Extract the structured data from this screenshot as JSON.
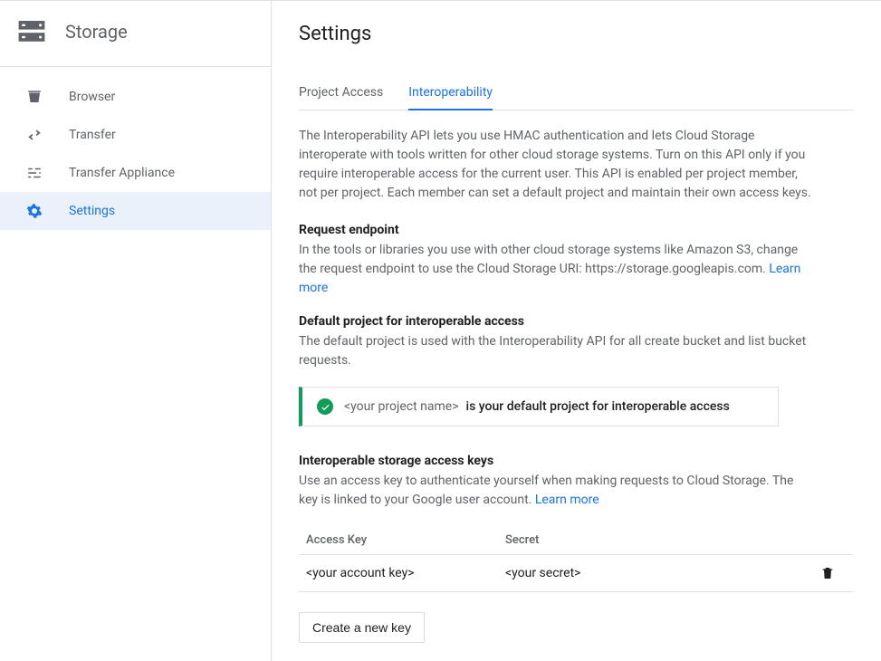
{
  "sidebar": {
    "product": "Storage",
    "items": [
      {
        "label": "Browser"
      },
      {
        "label": "Transfer"
      },
      {
        "label": "Transfer Appliance"
      },
      {
        "label": "Settings"
      }
    ]
  },
  "page": {
    "title": "Settings"
  },
  "tabs": [
    {
      "label": "Project Access"
    },
    {
      "label": "Interoperability"
    }
  ],
  "intro": "The Interoperability API lets you use HMAC authentication and lets Cloud Storage interoperate with tools written for other cloud storage systems. Turn on this API only if you require interoperable access for the current user. This API is enabled per project member, not per project. Each member can set a default project and maintain their own access keys.",
  "request_endpoint": {
    "title": "Request endpoint",
    "text": "In the tools or libraries you use with other cloud storage systems like Amazon S3, change the request endpoint to use the Cloud Storage URI: https://storage.googleapis.com. ",
    "learn_more": "Learn more"
  },
  "default_project": {
    "title": "Default project for interoperable access",
    "text": "The default project is used with the Interoperability API for all create bucket and list bucket requests.",
    "project_name": "<your project name>",
    "message": "is your default project for interoperable access"
  },
  "access_keys": {
    "title": "Interoperable storage access keys",
    "text": "Use an access key to authenticate yourself when making requests to Cloud Storage. The key is linked to your Google user account. ",
    "learn_more": "Learn more",
    "columns": {
      "key": "Access Key",
      "secret": "Secret"
    },
    "rows": [
      {
        "key": "<your account key>",
        "secret": "<your secret>"
      }
    ],
    "create_btn": "Create a new key"
  }
}
